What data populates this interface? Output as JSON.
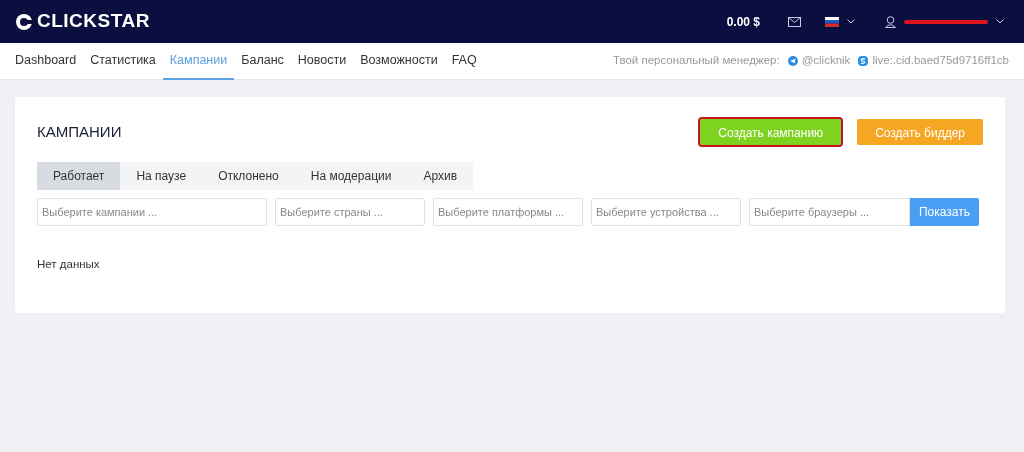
{
  "header": {
    "logo": "CLICKSTAR",
    "balance": "0.00 $",
    "language": {
      "kind": "ru"
    },
    "user": {
      "email_redacted": true
    }
  },
  "nav": [
    {
      "label": "Dashboard",
      "selected": false
    },
    {
      "label": "Статистика",
      "selected": false
    },
    {
      "label": "Кампании",
      "selected": true
    },
    {
      "label": "Баланс",
      "selected": false
    },
    {
      "label": "Новости",
      "selected": false
    },
    {
      "label": "Возможности",
      "selected": false
    },
    {
      "label": "FAQ",
      "selected": false
    }
  ],
  "manager": {
    "label": "Твой персональный менеджер:",
    "contacts": [
      {
        "kind": "telegram",
        "text": "@clicknik"
      },
      {
        "kind": "skype",
        "text": "live:.cid.baed75d9716ff1cb"
      }
    ]
  },
  "page": {
    "title": "КАМПАНИИ",
    "actions": [
      {
        "label": "Создать кампанию",
        "kind": "green",
        "highlighted": true
      },
      {
        "label": "Создать биддер",
        "kind": "orange",
        "highlighted": false
      }
    ],
    "tabs": [
      {
        "label": "Работает",
        "selected": true
      },
      {
        "label": "На паузе",
        "selected": false
      },
      {
        "label": "Отклонено",
        "selected": false
      },
      {
        "label": "На модерации",
        "selected": false
      },
      {
        "label": "Архив",
        "selected": false
      }
    ],
    "filters": [
      {
        "placeholder": "Выберите кампании ..."
      },
      {
        "placeholder": "Выберите страны ..."
      },
      {
        "placeholder": "Выберите платформы ..."
      },
      {
        "placeholder": "Выберите устройства ..."
      },
      {
        "placeholder": "Выберите браузеры ..."
      }
    ],
    "submit": "Показать",
    "empty": "Нет данных"
  }
}
